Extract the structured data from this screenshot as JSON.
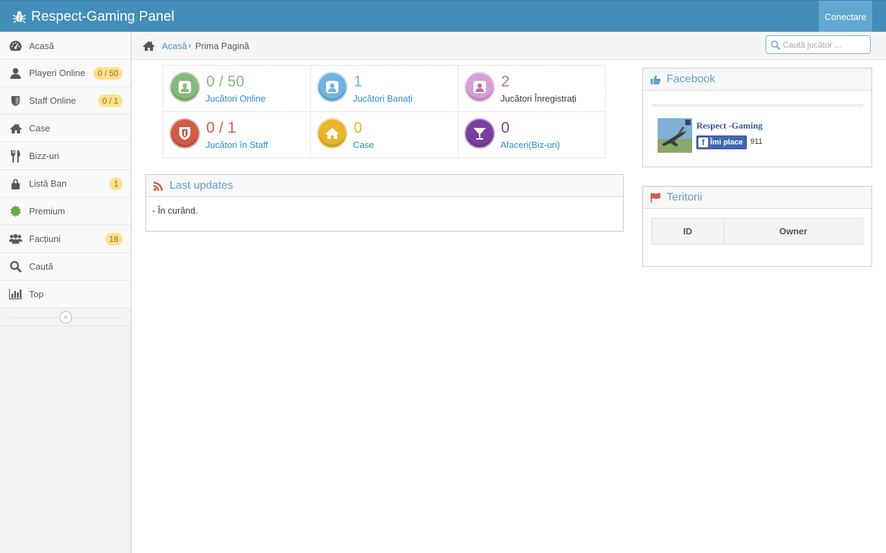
{
  "navbar": {
    "brand": "Respect-Gaming Panel",
    "brand_icon": "bug-icon",
    "connect_label": "Conectare"
  },
  "sidebar": {
    "items": [
      {
        "label": "Acasă",
        "icon": "dashboard-icon"
      },
      {
        "label": "Playeri Online",
        "icon": "user-icon",
        "badge": "0 / 50"
      },
      {
        "label": "Staff Online",
        "icon": "shield-icon",
        "badge": "0 / 1"
      },
      {
        "label": "Case",
        "icon": "home-icon"
      },
      {
        "label": "Bizz-uri",
        "icon": "cutlery-icon"
      },
      {
        "label": "Listă Ban",
        "icon": "lock-icon",
        "badge": "1"
      },
      {
        "label": "Premium",
        "icon": "certificate-icon"
      },
      {
        "label": "Facțiuni",
        "icon": "group-icon",
        "badge": "18"
      },
      {
        "label": "Caută",
        "icon": "search-icon"
      },
      {
        "label": "Top",
        "icon": "bar-chart-icon"
      }
    ],
    "collapse_icon": "double-angle-left-icon"
  },
  "breadcrumbs": {
    "home_link": "Acasă",
    "separator": "›",
    "active": "Prima Pagină"
  },
  "search": {
    "placeholder": "Caută jucător ..."
  },
  "stats": [
    {
      "value": "0 / 50",
      "label": "Jucători Online",
      "color": "#87b87f",
      "icon": "user-icon",
      "link": true
    },
    {
      "value": "1",
      "label": "Jucători Banați",
      "color": "#6fb3e0",
      "icon": "user-icon",
      "link": true
    },
    {
      "value": "2",
      "label": "Jucători Înregistrați",
      "color": "#c6699f",
      "icon": "user-icon",
      "link": false
    },
    {
      "value": "0 / 1",
      "label": "Jucători în Staff",
      "color": "#d15b47",
      "icon": "shield-icon",
      "link": true
    },
    {
      "value": "0",
      "label": "Case",
      "color": "#e7b52d",
      "icon": "home-icon",
      "link": true
    },
    {
      "value": "0",
      "label": "Afaceri(Biz-uri)",
      "color": "#7b3f9e",
      "icon": "glass-icon",
      "link": true
    }
  ],
  "last_updates": {
    "title": "Last updates",
    "icon": "rss-icon",
    "content": "- În curând."
  },
  "facebook": {
    "title": "Facebook",
    "icon": "thumbs-up-icon",
    "page_name": "Respect -Gaming",
    "like_label": "Îmi place",
    "like_count": "911"
  },
  "teritorii": {
    "title": "Teritorii",
    "icon": "flag-icon",
    "columns": [
      "ID",
      "Owner"
    ]
  },
  "colors": {
    "navbar": "#438eb9",
    "accent": "#4c8fbd",
    "badge": "#fee188"
  }
}
